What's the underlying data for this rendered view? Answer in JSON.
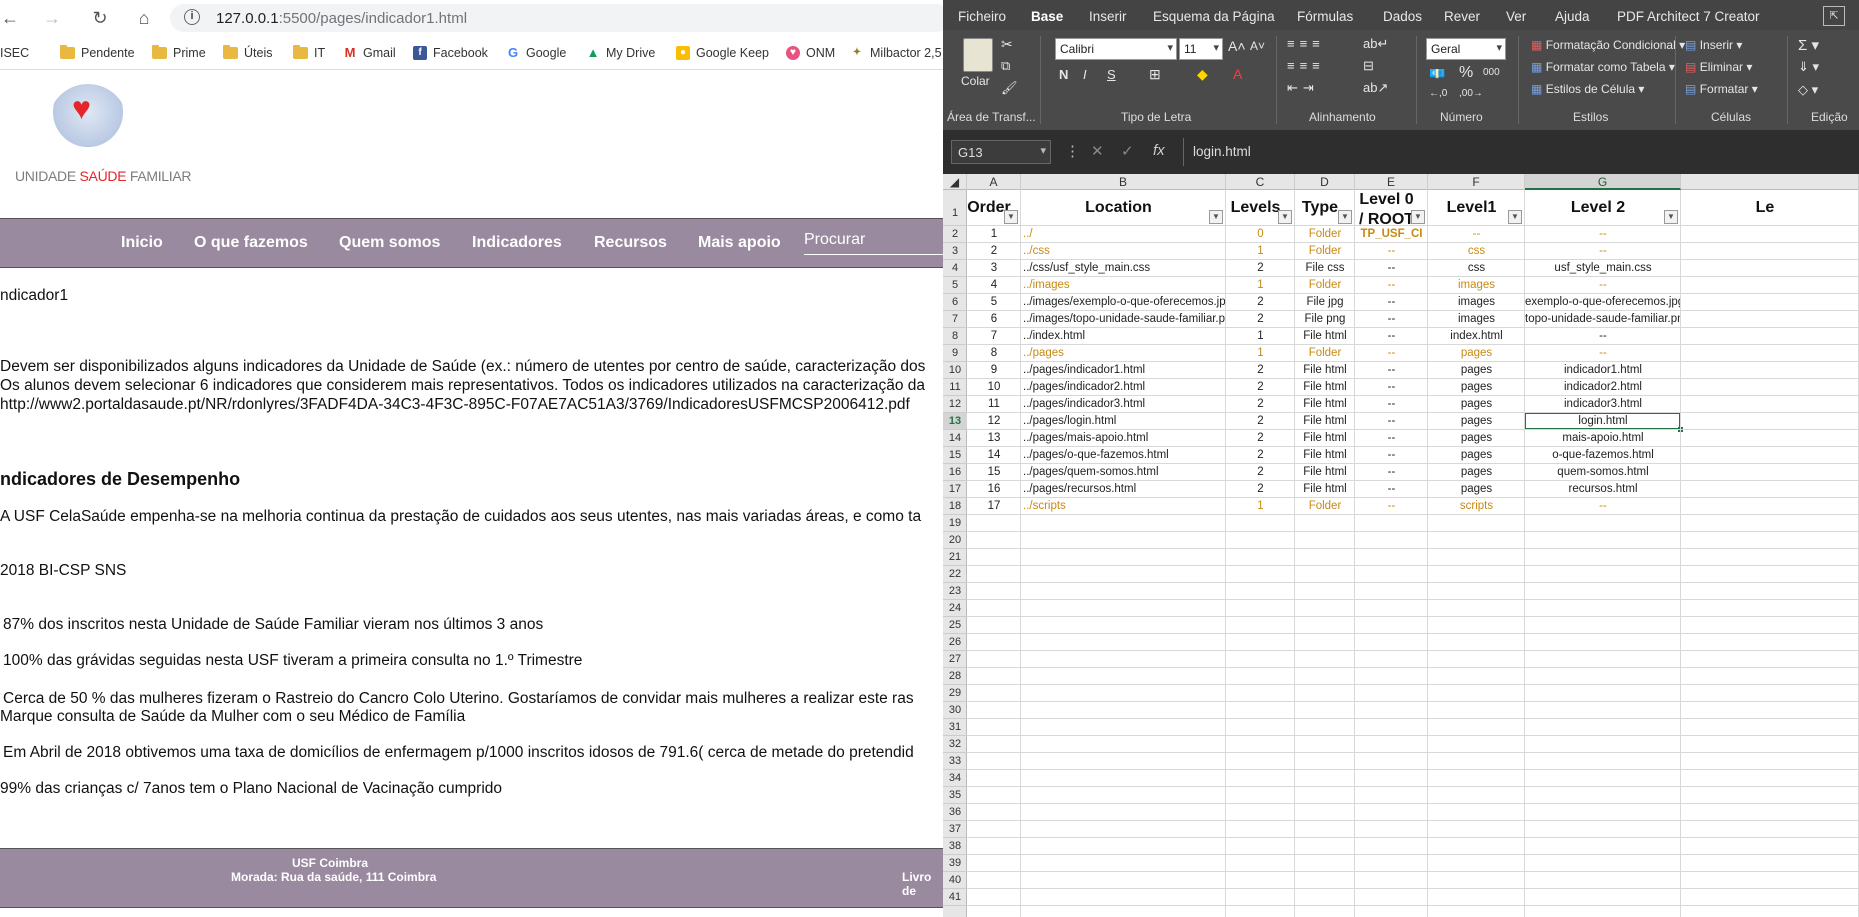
{
  "browser": {
    "url_host": "127.0.0.1",
    "url_path": ":5500/pages/indicador1.html",
    "bookmarks": [
      "ISEC",
      "Pendente",
      "Prime",
      "Úteis",
      "IT",
      "Gmail",
      "Facebook",
      "Google",
      "My Drive",
      "Google Keep",
      "ONM",
      "Milbactor 2,5"
    ]
  },
  "site": {
    "logo_text_1": "UNIDADE ",
    "logo_text_2": "SAÚDE",
    "logo_text_3": " FAMILIAR",
    "menu": [
      "Inicio",
      "O que fazemos",
      "Quem somos",
      "Indicadores",
      "Recursos",
      "Mais apoio"
    ],
    "search_placeholder": "Procurar",
    "page_title": "ndicador1",
    "intro_1": "Devem ser disponibilizados alguns indicadores da Unidade de Saúde (ex.: número de utentes por centro de saúde, caracterização dos",
    "intro_2": "Os alunos devem selecionar 6 indicadores que considerem mais representativos. Todos os indicadores utilizados na caracterização da",
    "intro_3": "http://www2.portaldasaude.pt/NR/rdonlyres/3FADF4DA-34C3-4F3C-895C-F07AE7AC51A3/3769/IndicadoresUSFMCSP2006412.pdf",
    "section_title": "ndicadores de Desempenho",
    "section_text": "A USF CelaSaúde empenha-se na melhoria continua da prestação de cuidados aos seus utentes, nas mais variadas áreas, e como ta",
    "year_label": "2018 BI-CSP SNS",
    "items": [
      "87% dos inscritos nesta Unidade de Saúde Familiar vieram nos últimos 3 anos",
      "100% das grávidas seguidas nesta USF tiveram a primeira consulta no 1.º Trimestre",
      "Cerca de 50 % das mulheres fizeram o Rastreio do Cancro Colo Uterino. Gostaríamos de convidar mais mulheres a realizar este ras",
      "Marque consulta de Saúde da Mulher com o seu Médico de Família",
      "Em Abril de 2018 obtivemos uma taxa de domicílios de enfermagem p/1000 inscritos idosos de 791.6( cerca de metade do pretendid",
      "99% das crianças c/ 7anos tem o Plano Nacional de Vacinação cumprido"
    ],
    "footer_1": "USF Coimbra",
    "footer_2": "Morada: Rua da saúde, 111 Coimbra",
    "footer_3": "Livro de"
  },
  "excel": {
    "tabs": [
      "Ficheiro",
      "Base",
      "Inserir",
      "Esquema da Página",
      "Fórmulas",
      "Dados",
      "Rever",
      "Ver",
      "Ajuda",
      "PDF Architect 7 Creator"
    ],
    "ribbon": {
      "paste": "Colar",
      "clipboard_group": "Área de Transf...",
      "font_name": "Calibri",
      "font_size": "11",
      "font_group": "Tipo de Letra",
      "bold": "N",
      "italic": "I",
      "underline": "S",
      "align_group": "Alinhamento",
      "number_format": "Geral",
      "number_group": "Número",
      "cond_format": "Formatação Condicional",
      "format_table": "Formatar como Tabela",
      "cell_styles": "Estilos de Célula",
      "styles_group": "Estilos",
      "insert": "Inserir",
      "delete": "Eliminar",
      "format": "Formatar",
      "cells_group": "Células",
      "edit_group": "Edição"
    },
    "name_box": "G13",
    "formula": "login.html",
    "columns": [
      "A",
      "B",
      "C",
      "D",
      "E",
      "F",
      "G"
    ],
    "headers": [
      "Order",
      "Location",
      "Levels",
      "Type",
      "Level 0 / ROOT",
      "Level1",
      "Level 2",
      "Le"
    ],
    "rows": [
      {
        "o": "1",
        "loc": "../",
        "lvl": "0",
        "type": "Folder",
        "l0": "TP_USF_CI",
        "l1": "--",
        "l2": "--",
        "orange": true
      },
      {
        "o": "2",
        "loc": "../css",
        "lvl": "1",
        "type": "Folder",
        "l0": "--",
        "l1": "css",
        "l2": "--",
        "orange": true
      },
      {
        "o": "3",
        "loc": "../css/usf_style_main.css",
        "lvl": "2",
        "type": "File css",
        "l0": "--",
        "l1": "css",
        "l2": "usf_style_main.css",
        "orange": false
      },
      {
        "o": "4",
        "loc": "../images",
        "lvl": "1",
        "type": "Folder",
        "l0": "--",
        "l1": "images",
        "l2": "--",
        "orange": true
      },
      {
        "o": "5",
        "loc": "../images/exemplo-o-que-oferecemos.jpg",
        "lvl": "2",
        "type": "File jpg",
        "l0": "--",
        "l1": "images",
        "l2": "exemplo-o-que-oferecemos.jpg",
        "orange": false
      },
      {
        "o": "6",
        "loc": "../images/topo-unidade-saude-familiar.png",
        "lvl": "2",
        "type": "File png",
        "l0": "--",
        "l1": "images",
        "l2": "topo-unidade-saude-familiar.png",
        "orange": false
      },
      {
        "o": "7",
        "loc": "../index.html",
        "lvl": "1",
        "type": "File html",
        "l0": "--",
        "l1": "index.html",
        "l2": "--",
        "orange": false
      },
      {
        "o": "8",
        "loc": "../pages",
        "lvl": "1",
        "type": "Folder",
        "l0": "--",
        "l1": "pages",
        "l2": "--",
        "orange": true
      },
      {
        "o": "9",
        "loc": "../pages/indicador1.html",
        "lvl": "2",
        "type": "File html",
        "l0": "--",
        "l1": "pages",
        "l2": "indicador1.html",
        "orange": false
      },
      {
        "o": "10",
        "loc": "../pages/indicador2.html",
        "lvl": "2",
        "type": "File html",
        "l0": "--",
        "l1": "pages",
        "l2": "indicador2.html",
        "orange": false
      },
      {
        "o": "11",
        "loc": "../pages/indicador3.html",
        "lvl": "2",
        "type": "File html",
        "l0": "--",
        "l1": "pages",
        "l2": "indicador3.html",
        "orange": false
      },
      {
        "o": "12",
        "loc": "../pages/login.html",
        "lvl": "2",
        "type": "File html",
        "l0": "--",
        "l1": "pages",
        "l2": "login.html",
        "orange": false
      },
      {
        "o": "13",
        "loc": "../pages/mais-apoio.html",
        "lvl": "2",
        "type": "File html",
        "l0": "--",
        "l1": "pages",
        "l2": "mais-apoio.html",
        "orange": false
      },
      {
        "o": "14",
        "loc": "../pages/o-que-fazemos.html",
        "lvl": "2",
        "type": "File html",
        "l0": "--",
        "l1": "pages",
        "l2": "o-que-fazemos.html",
        "orange": false
      },
      {
        "o": "15",
        "loc": "../pages/quem-somos.html",
        "lvl": "2",
        "type": "File html",
        "l0": "--",
        "l1": "pages",
        "l2": "quem-somos.html",
        "orange": false
      },
      {
        "o": "16",
        "loc": "../pages/recursos.html",
        "lvl": "2",
        "type": "File html",
        "l0": "--",
        "l1": "pages",
        "l2": "recursos.html",
        "orange": false
      },
      {
        "o": "17",
        "loc": "../scripts",
        "lvl": "1",
        "type": "Folder",
        "l0": "--",
        "l1": "scripts",
        "l2": "--",
        "orange": true
      }
    ],
    "row_count": 41,
    "selected_row": 13,
    "colors": {
      "accent": "#217346",
      "folder_text": "#c88a12",
      "menu_bg": "#9a8aa0"
    }
  }
}
